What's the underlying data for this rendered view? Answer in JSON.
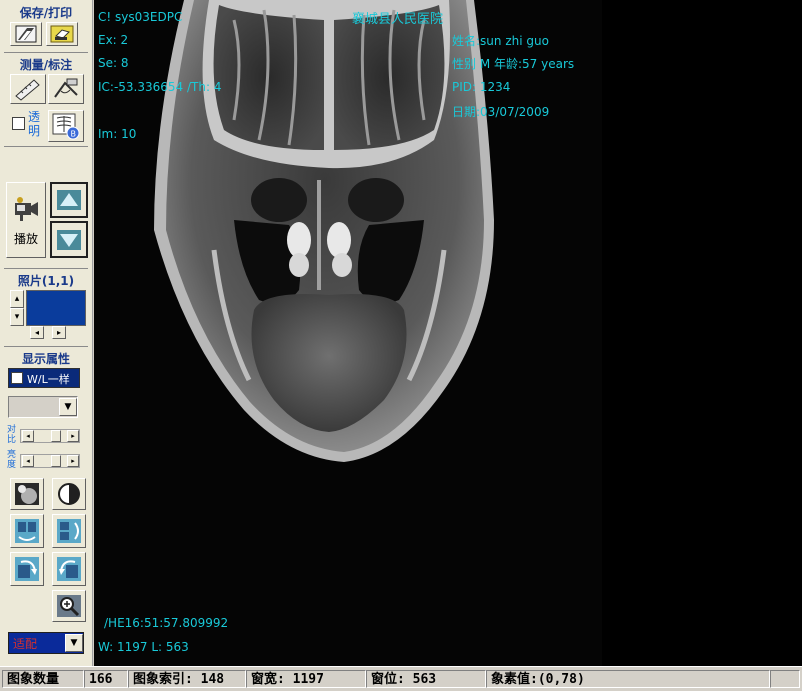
{
  "sidebar": {
    "save_print_title": "保存/打印",
    "measure_title": "测量/标注",
    "transparent_label": "透明",
    "play_label": "播放",
    "photo_title": "照片(1,1)",
    "display_title": "显示属性",
    "wl_same_label": "W/L一样",
    "contrast_label": "对比",
    "brightness_label": "亮度",
    "fit_select_value": "适配",
    "colors": {
      "blue_box": "#0a3c9c",
      "section_title": "#1a3a8a"
    }
  },
  "viewer": {
    "hospital": "襄城县人民医院",
    "modality_line": "C! sys03EDPC",
    "ex": "Ex: 2",
    "se": "Se: 8",
    "ic": "IC:-53.336654 /Th: 4",
    "im": "Im: 10",
    "name": "姓名:sun zhi guo",
    "sex_age": "性别 M  年龄:57 years",
    "pid": "PID: 1234",
    "date": "日期:03/07/2009",
    "timestamp": "/HE16:51:57.809992",
    "wl": "W: 1197 L: 563",
    "overlay_color": "#19c9d8"
  },
  "statusbar": {
    "image_count_label": "图象数量",
    "image_count": "166",
    "image_index": "图象索引: 148",
    "window_width": "窗宽: 1197",
    "window_level": "窗位: 563",
    "pixel_value": "象素值:(0,78)"
  }
}
